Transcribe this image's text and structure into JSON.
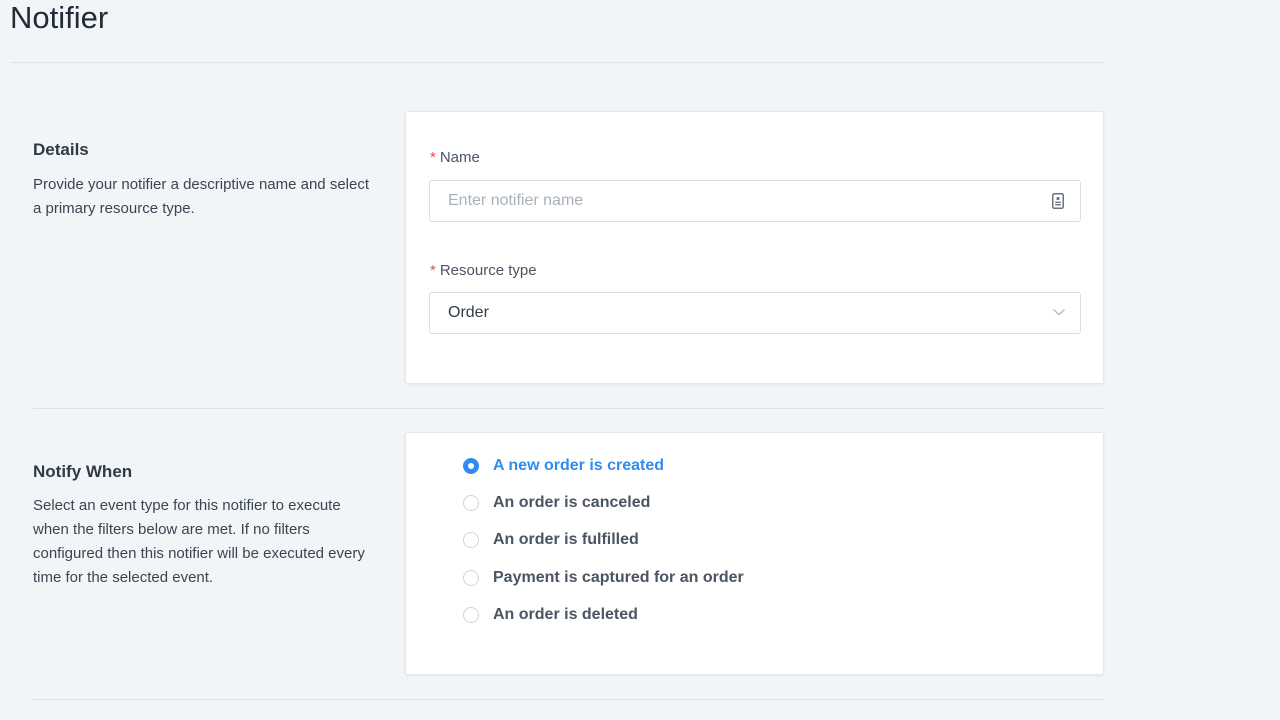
{
  "page": {
    "title": "Notifier"
  },
  "details": {
    "heading": "Details",
    "description": "Provide your notifier a descriptive name and select a primary resource type.",
    "name_field": {
      "required_mark": "*",
      "label": "Name",
      "placeholder": "Enter notifier name",
      "value": "",
      "icon": "id-card-icon"
    },
    "resource_type_field": {
      "required_mark": "*",
      "label": "Resource type",
      "selected": "Order",
      "icon": "chevron-down-icon"
    }
  },
  "notify_when": {
    "heading": "Notify When",
    "description": "Select an event type for this notifier to execute when the filters below are met. If no filters configured then this notifier will be executed every time for the selected event.",
    "options": [
      {
        "label": "A new order is created",
        "checked": true
      },
      {
        "label": "An order is canceled",
        "checked": false
      },
      {
        "label": "An order is fulfilled",
        "checked": false
      },
      {
        "label": "Payment is captured for an order",
        "checked": false
      },
      {
        "label": "An order is deleted",
        "checked": false
      }
    ]
  },
  "colors": {
    "accent": "#2f8cf0",
    "required": "#e5484d",
    "background": "#f2f5f8"
  }
}
